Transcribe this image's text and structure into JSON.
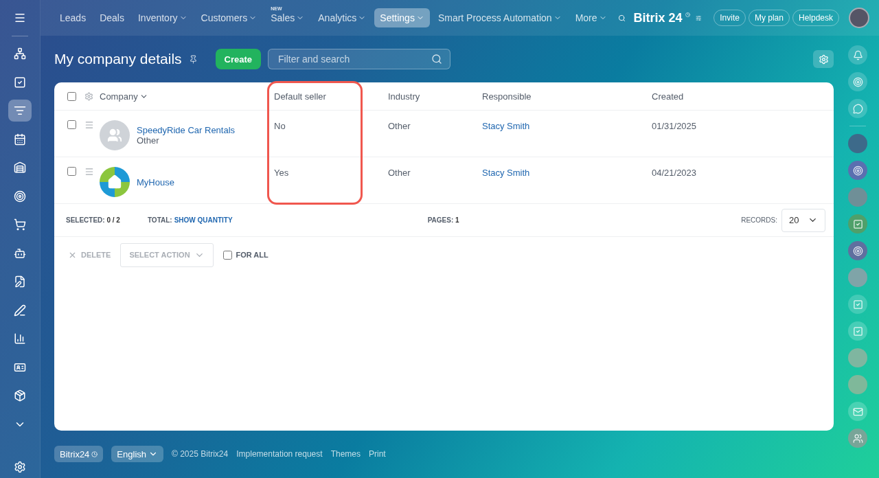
{
  "top_nav": {
    "items": [
      {
        "label": "Leads",
        "caret": false,
        "selected": false
      },
      {
        "label": "Deals",
        "caret": false,
        "selected": false
      },
      {
        "label": "Inventory",
        "caret": true,
        "selected": false
      },
      {
        "label": "Customers",
        "caret": true,
        "selected": false
      },
      {
        "label": "Sales",
        "caret": true,
        "selected": false,
        "badge": "NEW"
      },
      {
        "label": "Analytics",
        "caret": true,
        "selected": false
      },
      {
        "label": "Settings",
        "caret": true,
        "selected": true
      },
      {
        "label": "Smart Process Automation",
        "caret": true,
        "selected": false
      },
      {
        "label": "More",
        "caret": true,
        "selected": false
      }
    ],
    "logo": "Bitrix 24",
    "buttons": [
      "Invite",
      "My plan",
      "Helpdesk"
    ]
  },
  "page": {
    "title": "My company details",
    "create_button": "Create",
    "search": {
      "placeholder": "Filter and search"
    }
  },
  "table": {
    "select_all": {
      "checked": false
    },
    "columns": [
      "Company",
      "Default seller",
      "Industry",
      "Responsible",
      "Created"
    ],
    "rows": [
      {
        "checked": false,
        "kind": "placeholder",
        "company": "SpeedyRide Car Rentals",
        "company_type": "Other",
        "default_seller": "No",
        "industry": "Other",
        "responsible": "Stacy Smith",
        "created": "01/31/2025"
      },
      {
        "checked": false,
        "kind": "logo",
        "company": "MyHouse",
        "default_seller": "Yes",
        "industry": "Other",
        "responsible": "Stacy Smith",
        "created": "04/21/2023"
      }
    ],
    "summary": {
      "selected_label": "SELECTED:",
      "selected_value": "0 / 2",
      "total_label": "TOTAL:",
      "total_link": "SHOW QUANTITY",
      "pages_label": "PAGES:",
      "pages_value": "1",
      "records_label": "RECORDS:",
      "records_value": "20"
    },
    "actions": {
      "delete": "DELETE",
      "select_action": "SELECT ACTION",
      "for_all": {
        "label": "FOR ALL",
        "checked": false
      }
    }
  },
  "footer": {
    "brand": "Bitrix24",
    "language": "English",
    "copyright": "© 2025 Bitrix24",
    "links": [
      "Implementation request",
      "Themes",
      "Print"
    ]
  }
}
